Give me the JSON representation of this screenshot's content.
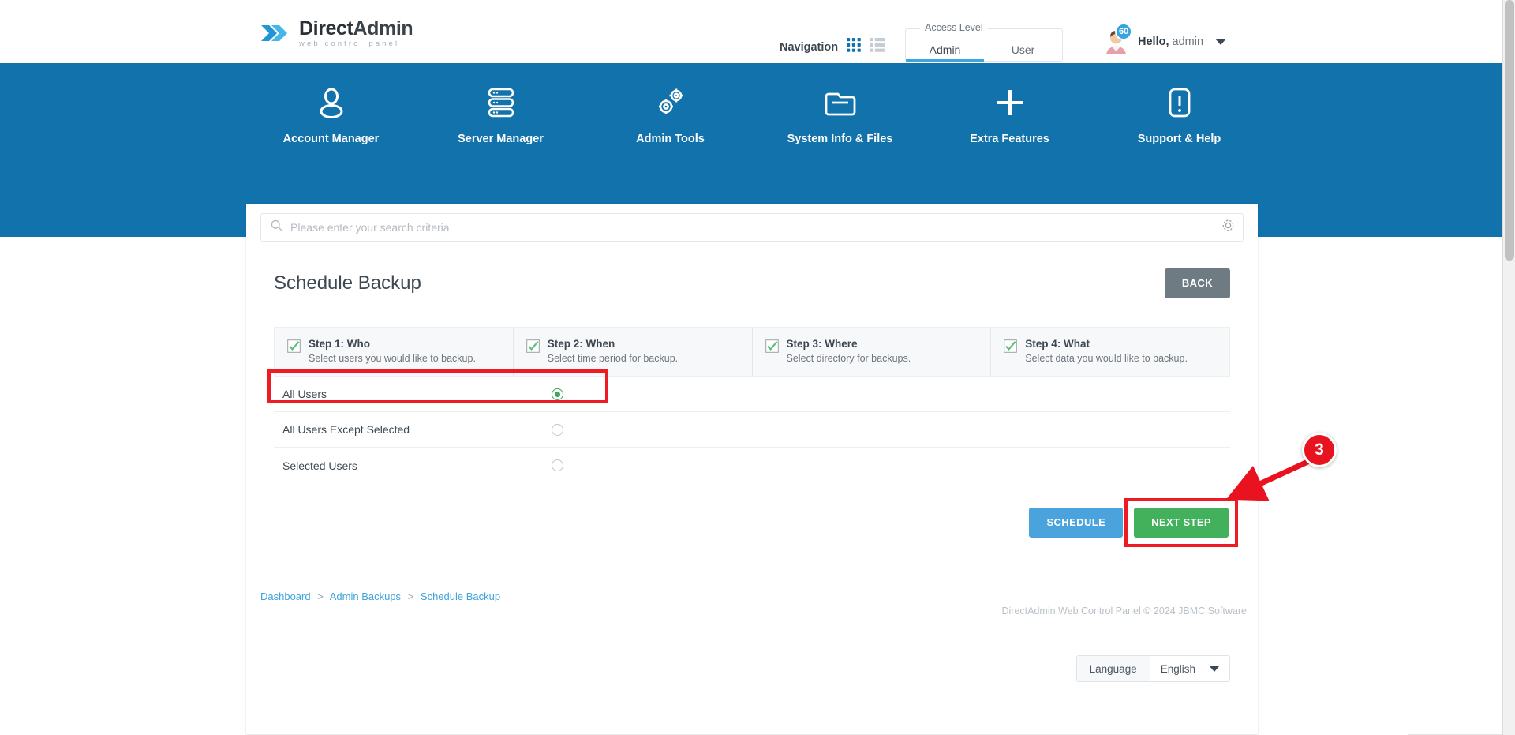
{
  "brand": {
    "name_first": "Direct",
    "name_second": "Admin",
    "tagline": "web control panel",
    "accent": "#1272ab",
    "logo_icon": "double-chevron-icon"
  },
  "header": {
    "navigation_label": "Navigation",
    "grid_view_icon": "grid-view-icon",
    "list_view_icon": "list-view-icon",
    "grid_active": true,
    "access_level": {
      "legend": "Access Level",
      "tabs": [
        {
          "label": "Admin",
          "active": true
        },
        {
          "label": "User",
          "active": false
        }
      ]
    },
    "user": {
      "avatar_icon": "user-avatar-icon",
      "notification_count": "60",
      "greeting_bold": "Hello,",
      "greeting_name": "admin",
      "caret_icon": "chevron-down-icon"
    }
  },
  "mainnav": [
    {
      "label": "Account Manager",
      "icon": "user-icon"
    },
    {
      "label": "Server Manager",
      "icon": "server-stack-icon"
    },
    {
      "label": "Admin Tools",
      "icon": "double-gear-icon"
    },
    {
      "label": "System Info & Files",
      "icon": "folder-icon"
    },
    {
      "label": "Extra Features",
      "icon": "plus-icon"
    },
    {
      "label": "Support & Help",
      "icon": "exclamation-square-icon"
    }
  ],
  "search": {
    "placeholder": "Please enter your search criteria",
    "value": "",
    "search_icon": "search-icon",
    "settings_icon": "gear-icon"
  },
  "page": {
    "title": "Schedule Backup",
    "back_label": "BACK"
  },
  "steps": [
    {
      "title": "Step 1: Who",
      "subtitle": "Select users you would like to backup.",
      "checked": true
    },
    {
      "title": "Step 2: When",
      "subtitle": "Select time period for backup.",
      "checked": true
    },
    {
      "title": "Step 3: Where",
      "subtitle": "Select directory for backups.",
      "checked": true
    },
    {
      "title": "Step 4: What",
      "subtitle": "Select data you would like to backup.",
      "checked": true
    }
  ],
  "options": [
    {
      "label": "All Users",
      "selected": true,
      "highlighted": true
    },
    {
      "label": "All Users Except Selected",
      "selected": false,
      "highlighted": false
    },
    {
      "label": "Selected Users",
      "selected": false,
      "highlighted": false
    }
  ],
  "actions": {
    "schedule_label": "SCHEDULE",
    "next_label": "NEXT STEP",
    "next_highlighted": true
  },
  "annotation": {
    "step_number": "3",
    "color": "#e8131f"
  },
  "language": {
    "label": "Language",
    "value": "English",
    "caret_icon": "chevron-down-icon"
  },
  "breadcrumb": [
    {
      "label": "Dashboard",
      "link": true
    },
    {
      "label": "Admin Backups",
      "link": true
    },
    {
      "label": "Schedule Backup",
      "link": true
    }
  ],
  "breadcrumb_separator": ">",
  "footer": {
    "note": "DirectAdmin Web Control Panel © 2024 JBMC Software"
  }
}
